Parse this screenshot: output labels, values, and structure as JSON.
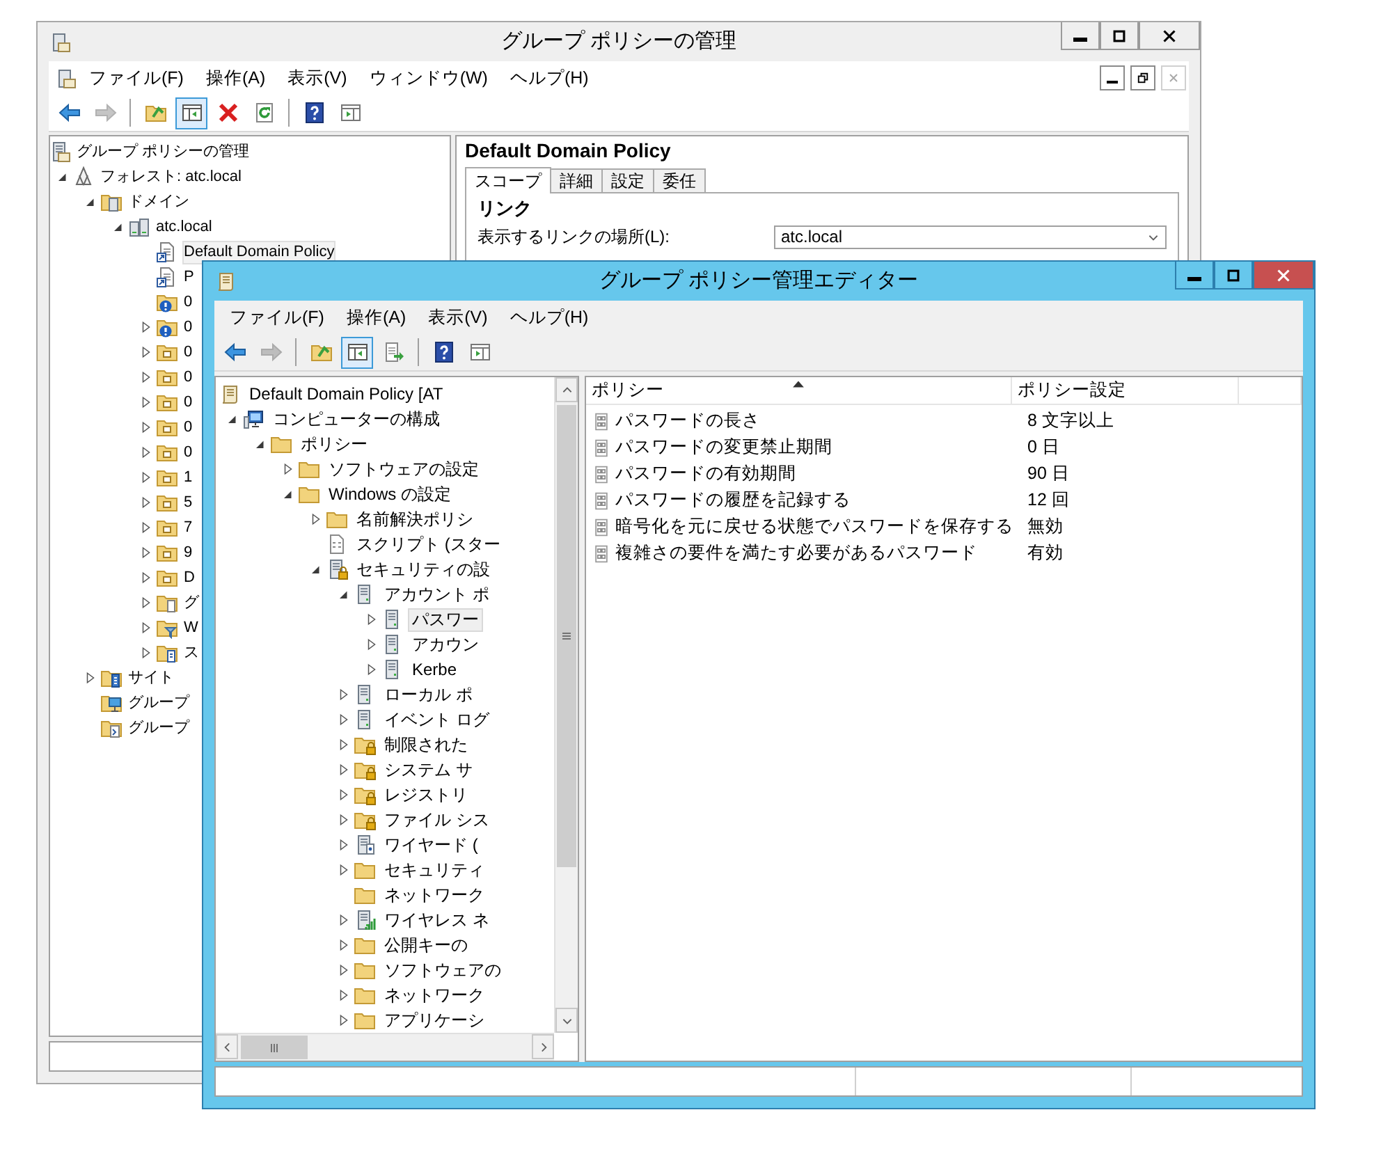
{
  "management_window": {
    "title": "グループ ポリシーの管理",
    "mdi_buttons": [
      {
        "kind": "minimize",
        "disabled": false
      },
      {
        "kind": "restore",
        "disabled": false
      },
      {
        "kind": "close",
        "disabled": true
      }
    ],
    "menu": [
      "ファイル(F)",
      "操作(A)",
      "表示(V)",
      "ウィンドウ(W)",
      "ヘルプ(H)"
    ],
    "toolbar": [
      {
        "kind": "back",
        "pressed": false,
        "disabled": false
      },
      {
        "kind": "forward",
        "pressed": false,
        "disabled": true
      },
      {
        "kind": "separator"
      },
      {
        "kind": "up",
        "pressed": false,
        "disabled": false
      },
      {
        "kind": "tree",
        "pressed": true,
        "disabled": false
      },
      {
        "kind": "delete",
        "pressed": false,
        "disabled": false
      },
      {
        "kind": "refresh",
        "pressed": false,
        "disabled": false
      },
      {
        "kind": "separator"
      },
      {
        "kind": "help",
        "pressed": false,
        "disabled": false
      },
      {
        "kind": "actions",
        "pressed": false,
        "disabled": false
      }
    ],
    "tree": [
      {
        "label": "グループ ポリシーの管理",
        "kind": "console",
        "selected": false,
        "children": [
          {
            "label": "フォレスト: atc.local",
            "kind": "forest",
            "selected": false,
            "expanded": true,
            "children": [
              {
                "label": "ドメイン",
                "kind": "domains",
                "selected": false,
                "expanded": true,
                "children": [
                  {
                    "label": "atc.local",
                    "kind": "domain",
                    "selected": false,
                    "expanded": true,
                    "children": [
                      {
                        "label": "Default Domain Policy",
                        "kind": "gpolink",
                        "selected": true
                      },
                      {
                        "label": "P",
                        "kind": "gpolink",
                        "selected": false
                      },
                      {
                        "label": "0",
                        "kind": "blocked",
                        "selected": false
                      },
                      {
                        "label": "0",
                        "kind": "blocked",
                        "selected": false,
                        "expanded": false
                      },
                      {
                        "label": "0",
                        "kind": "unit",
                        "selected": false,
                        "expanded": false
                      },
                      {
                        "label": "0",
                        "kind": "unit",
                        "selected": false,
                        "expanded": false
                      },
                      {
                        "label": "0",
                        "kind": "unit",
                        "selected": false,
                        "expanded": false
                      },
                      {
                        "label": "0",
                        "kind": "unit",
                        "selected": false,
                        "expanded": false
                      },
                      {
                        "label": "0",
                        "kind": "unit",
                        "selected": false,
                        "expanded": false
                      },
                      {
                        "label": "1",
                        "kind": "unit",
                        "selected": false,
                        "expanded": false
                      },
                      {
                        "label": "5",
                        "kind": "unit",
                        "selected": false,
                        "expanded": false
                      },
                      {
                        "label": "7",
                        "kind": "unit",
                        "selected": false,
                        "expanded": false
                      },
                      {
                        "label": "9",
                        "kind": "unit",
                        "selected": false,
                        "expanded": false
                      },
                      {
                        "label": "D",
                        "kind": "unit",
                        "selected": false,
                        "expanded": false
                      },
                      {
                        "label": "グ",
                        "kind": "container",
                        "selected": false,
                        "expanded": false
                      },
                      {
                        "label": "W",
                        "kind": "filters",
                        "selected": false,
                        "expanded": false
                      },
                      {
                        "label": "ス",
                        "kind": "starters",
                        "selected": false,
                        "expanded": false
                      }
                    ]
                  }
                ]
              },
              {
                "label": "サイト",
                "kind": "sites",
                "selected": false,
                "expanded": false
              },
              {
                "label": "グループ",
                "kind": "modeling",
                "selected": false
              },
              {
                "label": "グループ",
                "kind": "results",
                "selected": false
              }
            ]
          }
        ]
      }
    ],
    "details": {
      "heading": "Default Domain Policy",
      "tabs": [
        {
          "label": "スコープ",
          "selected": true
        },
        {
          "label": "詳細",
          "selected": false
        },
        {
          "label": "設定",
          "selected": false
        },
        {
          "label": "委任",
          "selected": false
        }
      ],
      "section": "リンク",
      "link_label": "表示するリンクの場所(L):",
      "link_location": "atc.local"
    }
  },
  "editor_window": {
    "title": "グループ ポリシー管理エディター",
    "menu": [
      "ファイル(F)",
      "操作(A)",
      "表示(V)",
      "ヘルプ(H)"
    ],
    "toolbar": [
      {
        "kind": "back",
        "pressed": false,
        "disabled": false
      },
      {
        "kind": "forward",
        "pressed": false,
        "disabled": true
      },
      {
        "kind": "separator"
      },
      {
        "kind": "up",
        "pressed": false,
        "disabled": false
      },
      {
        "kind": "tree",
        "pressed": true,
        "disabled": false
      },
      {
        "kind": "export",
        "pressed": false,
        "disabled": false
      },
      {
        "kind": "separator"
      },
      {
        "kind": "help",
        "pressed": false,
        "disabled": false
      },
      {
        "kind": "actions",
        "pressed": false,
        "disabled": false
      }
    ],
    "tree": [
      {
        "label": "Default Domain Policy [AT",
        "kind": "gpo",
        "selected": false,
        "children": [
          {
            "label": "コンピューターの構成",
            "kind": "computer",
            "selected": false,
            "expanded": true,
            "children": [
              {
                "label": "ポリシー",
                "kind": "folder",
                "selected": false,
                "expanded": true,
                "children": [
                  {
                    "label": "ソフトウェアの設定",
                    "kind": "folder",
                    "selected": false,
                    "expanded": false
                  },
                  {
                    "label": "Windows の設定",
                    "kind": "folder",
                    "selected": false,
                    "expanded": true,
                    "children": [
                      {
                        "label": "名前解決ポリシ",
                        "kind": "folder",
                        "selected": false,
                        "expanded": false
                      },
                      {
                        "label": "スクリプト (スター",
                        "kind": "script",
                        "selected": false
                      },
                      {
                        "label": "セキュリティの設",
                        "kind": "secured",
                        "selected": false,
                        "expanded": true,
                        "children": [
                          {
                            "label": "アカウント ポ",
                            "kind": "account",
                            "selected": false,
                            "expanded": true,
                            "children": [
                              {
                                "label": "パスワー",
                                "kind": "account",
                                "selected": true,
                                "expanded": false
                              },
                              {
                                "label": "アカウン",
                                "kind": "account",
                                "selected": false,
                                "expanded": false
                              },
                              {
                                "label": "Kerbe",
                                "kind": "account",
                                "selected": false,
                                "expanded": false
                              }
                            ]
                          },
                          {
                            "label": "ローカル ポ",
                            "kind": "account",
                            "selected": false,
                            "expanded": false
                          },
                          {
                            "label": "イベント ログ",
                            "kind": "account",
                            "selected": false,
                            "expanded": false
                          },
                          {
                            "label": "制限された",
                            "kind": "lockfolder",
                            "selected": false,
                            "expanded": false
                          },
                          {
                            "label": "システム サ",
                            "kind": "lockfolder",
                            "selected": false,
                            "expanded": false
                          },
                          {
                            "label": "レジストリ",
                            "kind": "lockfolder",
                            "selected": false,
                            "expanded": false
                          },
                          {
                            "label": "ファイル シス",
                            "kind": "lockfolder",
                            "selected": false,
                            "expanded": false
                          },
                          {
                            "label": "ワイヤード (",
                            "kind": "wired",
                            "selected": false,
                            "expanded": false
                          },
                          {
                            "label": "セキュリティ",
                            "kind": "folder",
                            "selected": false,
                            "expanded": false
                          },
                          {
                            "label": "ネットワーク",
                            "kind": "folder",
                            "selected": false
                          },
                          {
                            "label": "ワイヤレス ネ",
                            "kind": "wireless",
                            "selected": false,
                            "expanded": false
                          },
                          {
                            "label": "公開キーの",
                            "kind": "folder",
                            "selected": false,
                            "expanded": false
                          },
                          {
                            "label": "ソフトウェアの",
                            "kind": "folder",
                            "selected": false,
                            "expanded": false
                          },
                          {
                            "label": "ネットワーク",
                            "kind": "folder",
                            "selected": false,
                            "expanded": false
                          },
                          {
                            "label": "アプリケーシ",
                            "kind": "folder",
                            "selected": false,
                            "expanded": false
                          }
                        ]
                      }
                    ]
                  }
                ]
              }
            ]
          }
        ]
      }
    ],
    "list": {
      "columns": [
        {
          "label": "ポリシー",
          "sorted": true
        },
        {
          "label": "ポリシー設定",
          "sorted": false
        }
      ],
      "rows": [
        {
          "policy": "パスワードの長さ",
          "setting": "8 文字以上"
        },
        {
          "policy": "パスワードの変更禁止期間",
          "setting": "0 日"
        },
        {
          "policy": "パスワードの有効期間",
          "setting": "90 日"
        },
        {
          "policy": "パスワードの履歴を記録する",
          "setting": "12 回"
        },
        {
          "policy": "暗号化を元に戻せる状態でパスワードを保存する",
          "setting": "無効"
        },
        {
          "policy": "複雑さの要件を満たす必要があるパスワード",
          "setting": "有効"
        }
      ]
    }
  }
}
